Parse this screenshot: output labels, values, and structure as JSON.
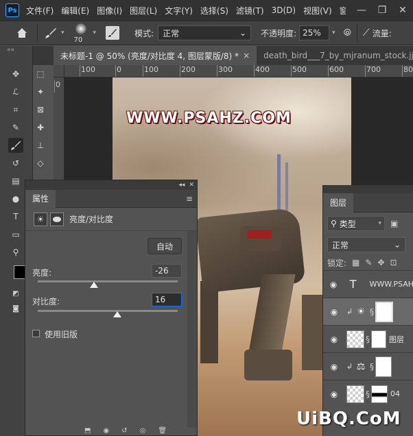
{
  "app": {
    "logo": "Ps"
  },
  "menu": [
    "文件(F)",
    "编辑(E)",
    "图像(I)",
    "图层(L)",
    "文字(Y)",
    "选择(S)",
    "滤镜(T)",
    "3D(D)",
    "视图(V)",
    "窗"
  ],
  "window_buttons": [
    "—",
    "❐",
    "✕"
  ],
  "options": {
    "brush_size": "70",
    "mode_label": "模式:",
    "mode_value": "正常",
    "opacity_label": "不透明度:",
    "opacity_value": "25%",
    "flow_label": "流量:"
  },
  "tabs": [
    {
      "label": "未标题-1 @ 50% (亮度/对比度 4, 图层蒙版/8) *",
      "close": "×"
    },
    {
      "label": "death_bird___7_by_mjranum_stock.jj"
    }
  ],
  "ruler_h": [
    "100",
    "0",
    "100",
    "200",
    "300",
    "400",
    "500",
    "600",
    "700",
    "800"
  ],
  "ruler_v": [
    "0"
  ],
  "canvas": {
    "watermark": "WWW.PSAHZ.COM"
  },
  "properties": {
    "tab": "属性",
    "title": "亮度/对比度",
    "auto_button": "自动",
    "brightness_label": "亮度:",
    "brightness_value": "-26",
    "contrast_label": "对比度:",
    "contrast_value": "16",
    "legacy_label": "使用旧版"
  },
  "layers": {
    "tab": "图层",
    "kind_label": "类型",
    "blend_mode": "正常",
    "lock_label": "锁定:",
    "items": [
      {
        "name": "WWW.PSAH",
        "type": "text"
      },
      {
        "name": "",
        "type": "adjustment-brightness"
      },
      {
        "name": "图层",
        "type": "image"
      },
      {
        "name": "",
        "type": "adjustment-balance"
      },
      {
        "name": "04",
        "type": "image-mask"
      }
    ]
  },
  "site_watermark": "UiBQ.CoM"
}
